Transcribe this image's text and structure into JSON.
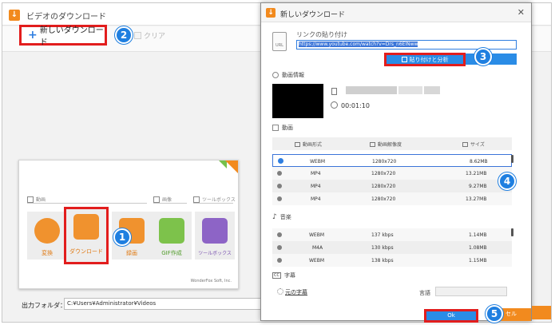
{
  "main_window": {
    "title": "ビデオのダウンロード",
    "new_download_label": "新しいダウンロード",
    "clear_label": "クリア",
    "output_label": "出力フォルダ：",
    "output_path": "C:¥Users¥Administrator¥Videos"
  },
  "launcher": {
    "categories": [
      "動画",
      "画像",
      "ツールボックス"
    ],
    "tiles": [
      {
        "label": "変換",
        "icon": "film-icon",
        "color": "#f0922e"
      },
      {
        "label": "ダウンロード",
        "icon": "download-icon",
        "color": "#f0922e"
      },
      {
        "label": "録画",
        "icon": "record-icon",
        "color": "#f0922e"
      },
      {
        "label": "GIF作成",
        "icon": "image-icon",
        "color": "#7dc24b"
      },
      {
        "label": "ツールボックス",
        "icon": "toolbox-icon",
        "color": "#8d64c6"
      }
    ],
    "footer": "WonderFox Soft, Inc."
  },
  "dialog": {
    "title": "新しいダウンロード",
    "paste_label": "リンクの貼り付け",
    "url_value": "https://www.youtube.com/watch?v=Drs_n6ElNww",
    "analyze_label": "貼り付けと分析",
    "video_info_label": "動画情報",
    "duration": "00:01:10",
    "video_section_label": "動画",
    "video_headers": [
      "動画形式",
      "動画解像度",
      "サイズ"
    ],
    "video_rows": [
      {
        "format": "WEBM",
        "resolution": "1280x720",
        "size": "8.62MB"
      },
      {
        "format": "MP4",
        "resolution": "1280x720",
        "size": "13.21MB"
      },
      {
        "format": "MP4",
        "resolution": "1280x720",
        "size": "9.27MB"
      },
      {
        "format": "MP4",
        "resolution": "1280x720",
        "size": "13.27MB"
      }
    ],
    "audio_section_label": "音楽",
    "audio_rows": [
      {
        "format": "WEBM",
        "bitrate": "137 kbps",
        "size": "1.14MB"
      },
      {
        "format": "M4A",
        "bitrate": "130 kbps",
        "size": "1.08MB"
      },
      {
        "format": "WEBM",
        "bitrate": "138 kbps",
        "size": "1.15MB"
      }
    ],
    "subtitle_section_label": "字幕",
    "original_subtitle_label": "元の字幕",
    "language_label": "言語",
    "ok_label": "Ok",
    "cancel_label": "セル"
  },
  "badges": [
    "1",
    "2",
    "3",
    "4",
    "5"
  ],
  "colors": {
    "accent_blue": "#2a8ce6",
    "highlight_red": "#e21d1d",
    "brand_orange": "#f28a1e"
  }
}
